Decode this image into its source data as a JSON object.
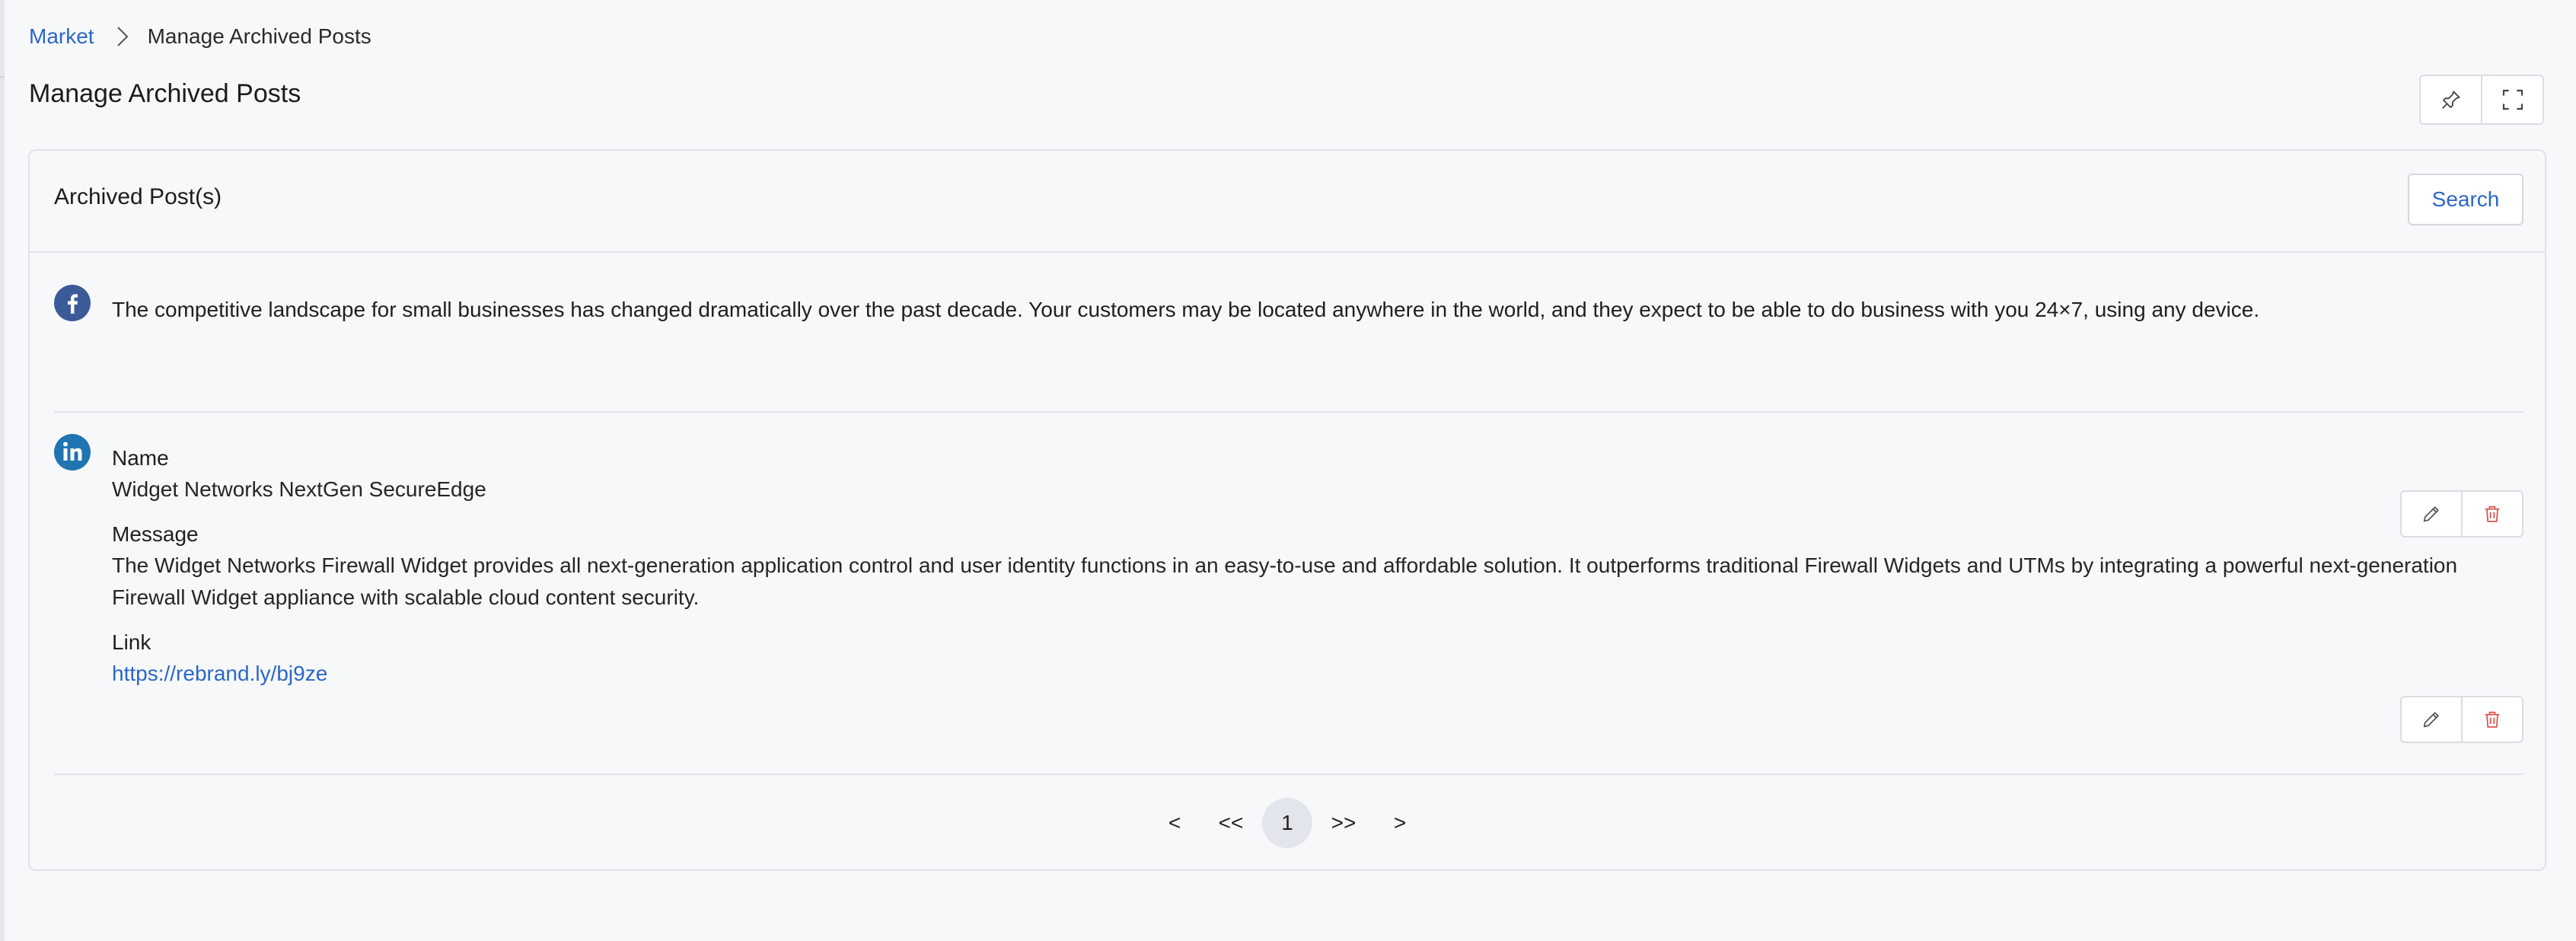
{
  "breadcrumb": {
    "parent": "Market",
    "current": "Manage Archived Posts"
  },
  "page": {
    "title": "Manage Archived Posts"
  },
  "card": {
    "title": "Archived Post(s)",
    "search_label": "Search"
  },
  "posts": [
    {
      "network_icon": "facebook-icon",
      "text": "The competitive landscape for small businesses has changed dramatically over the past decade. Your customers may be located anywhere in the world, and they expect to be able to do business with you 24×7, using any device."
    },
    {
      "network_icon": "linkedin-icon",
      "name_label": "Name",
      "name": "Widget Networks NextGen SecureEdge",
      "message_label": "Message",
      "message": "The Widget Networks Firewall Widget provides all next-generation application control and user identity functions in an easy-to-use and affordable solution. It outperforms traditional Firewall Widgets and UTMs by integrating a powerful next-generation Firewall Widget appliance with scalable cloud content security.",
      "link_label": "Link",
      "link": "https://rebrand.ly/bj9ze"
    }
  ],
  "pagination": {
    "prev": "<",
    "first": "<<",
    "current": "1",
    "last": ">>",
    "next": ">"
  },
  "colors": {
    "accent": "#2b67c6",
    "facebook": "#3a5a98",
    "linkedin": "#1f74b1",
    "delete": "#d9534f"
  }
}
